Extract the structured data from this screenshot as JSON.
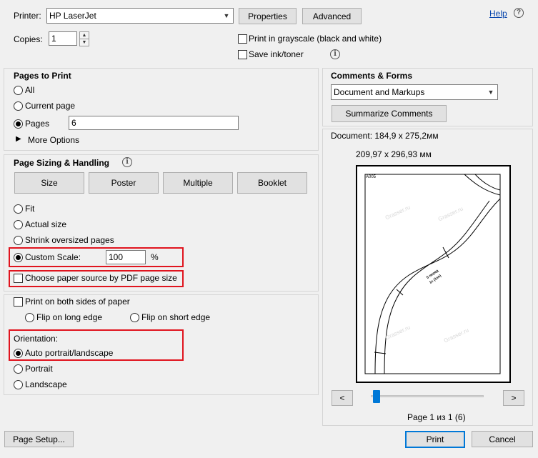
{
  "printer": {
    "label": "Printer:",
    "selected": "HP LaserJet",
    "properties_label": "Properties",
    "advanced_label": "Advanced",
    "help_label": "Help"
  },
  "copies": {
    "label": "Copies:",
    "value": "1"
  },
  "options": {
    "grayscale_label": "Print in grayscale (black and white)",
    "save_ink_label": "Save ink/toner"
  },
  "pages_to_print": {
    "title": "Pages to Print",
    "all_label": "All",
    "current_label": "Current page",
    "pages_label": "Pages",
    "pages_value": "6",
    "more_options_label": "More Options"
  },
  "sizing": {
    "title": "Page Sizing & Handling",
    "tabs": {
      "size": "Size",
      "poster": "Poster",
      "multiple": "Multiple",
      "booklet": "Booklet"
    },
    "fit_label": "Fit",
    "actual_label": "Actual size",
    "shrink_label": "Shrink oversized pages",
    "custom_label": "Custom Scale:",
    "custom_value": "100",
    "percent": "%",
    "paper_source_label": "Choose paper source by PDF page size"
  },
  "duplex": {
    "both_sides_label": "Print on both sides of paper",
    "long_edge_label": "Flip on long edge",
    "short_edge_label": "Flip on short edge"
  },
  "orientation": {
    "title": "Orientation:",
    "auto_label": "Auto portrait/landscape",
    "portrait_label": "Portrait",
    "landscape_label": "Landscape"
  },
  "comments": {
    "title": "Comments & Forms",
    "selected": "Document and Markups",
    "summarize_label": "Summarize Comments"
  },
  "preview": {
    "document_size": "Document: 184,9 x 275,2мм",
    "paper_size": "209,97 x 296,93 мм",
    "page_code": "A005",
    "watermark": "Grasser.ru",
    "annotation_line1": "5 перед",
    "annotation_line2": "1x (1sn)",
    "prev_label": "<",
    "next_label": ">",
    "page_status": "Page 1 из 1 (6)",
    "slider_position": 0.02
  },
  "footer": {
    "page_setup_label": "Page Setup...",
    "print_label": "Print",
    "cancel_label": "Cancel"
  },
  "colors": {
    "highlight": "#e0141e",
    "slider_thumb": "#0078d7",
    "link": "#0645ad"
  }
}
